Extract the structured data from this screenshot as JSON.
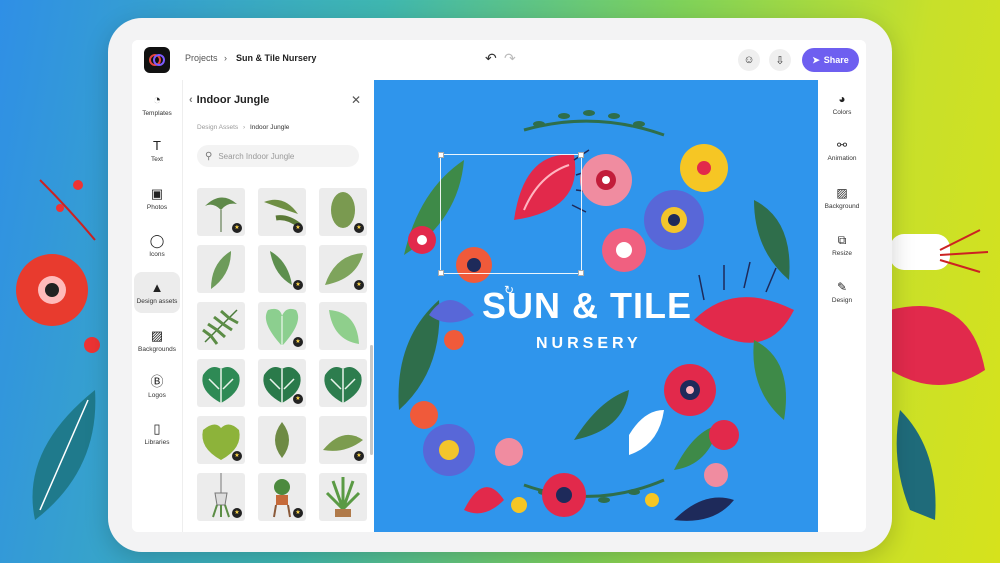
{
  "topbar": {
    "breadcrumb_root": "Projects",
    "breadcrumb_sep": "›",
    "project_name": "Sun & Tile Nursery",
    "undo": "↶",
    "redo": "↷",
    "share_label": "Share"
  },
  "left_rail": [
    {
      "label": "Templates",
      "icon": "templates-icon"
    },
    {
      "label": "Text",
      "icon": "text-icon"
    },
    {
      "label": "Photos",
      "icon": "photos-icon"
    },
    {
      "label": "Icons",
      "icon": "icons-icon"
    },
    {
      "label": "Design assets",
      "icon": "design-assets-icon",
      "active": true
    },
    {
      "label": "Backgrounds",
      "icon": "backgrounds-icon"
    },
    {
      "label": "Logos",
      "icon": "logos-icon"
    },
    {
      "label": "Libraries",
      "icon": "libraries-icon"
    }
  ],
  "panel": {
    "title": "Indoor Jungle",
    "back": "‹",
    "close": "✕",
    "breadcrumb_root": "Design Assets",
    "breadcrumb_sep": "›",
    "breadcrumb_current": "Indoor Jungle",
    "search_placeholder": "Search Indoor Jungle"
  },
  "canvas": {
    "title_line1": "SUN & TILE",
    "title_line2": "NURSERY"
  },
  "right_rail": [
    {
      "label": "Colors",
      "icon": "colors-icon"
    },
    {
      "label": "Animation",
      "icon": "animation-icon"
    },
    {
      "label": "Background",
      "icon": "background-icon"
    },
    {
      "label": "Resize",
      "icon": "resize-icon"
    },
    {
      "label": "Design",
      "icon": "design-icon"
    }
  ],
  "colors": {
    "accent": "#6e5ff0",
    "canvas": "#2f95ec"
  }
}
